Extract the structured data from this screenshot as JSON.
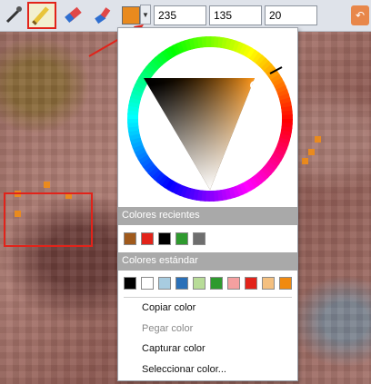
{
  "toolbar": {
    "current_color": "#e98a1e",
    "rgb": {
      "r": "235",
      "g": "135",
      "b": "20"
    },
    "tools": [
      "eyedropper-icon",
      "pencil-icon",
      "eraser-icon",
      "color-replace-icon"
    ]
  },
  "color_picker": {
    "recent_header": "Colores recientes",
    "recent_colors": [
      "#a05a1c",
      "#e2231a",
      "#000000",
      "#2e9a2e",
      "#6e6e6e"
    ],
    "standard_header": "Colores estándar",
    "standard_colors": [
      "#000000",
      "#ffffff",
      "#a8cce0",
      "#2a70b8",
      "#b8dc98",
      "#2e9a2e",
      "#f4a0a0",
      "#e2231a",
      "#f4c080",
      "#f08a10"
    ],
    "menu": {
      "copy": "Copiar color",
      "paste": "Pegar color",
      "capture": "Capturar color",
      "select": "Seleccionar color..."
    }
  }
}
